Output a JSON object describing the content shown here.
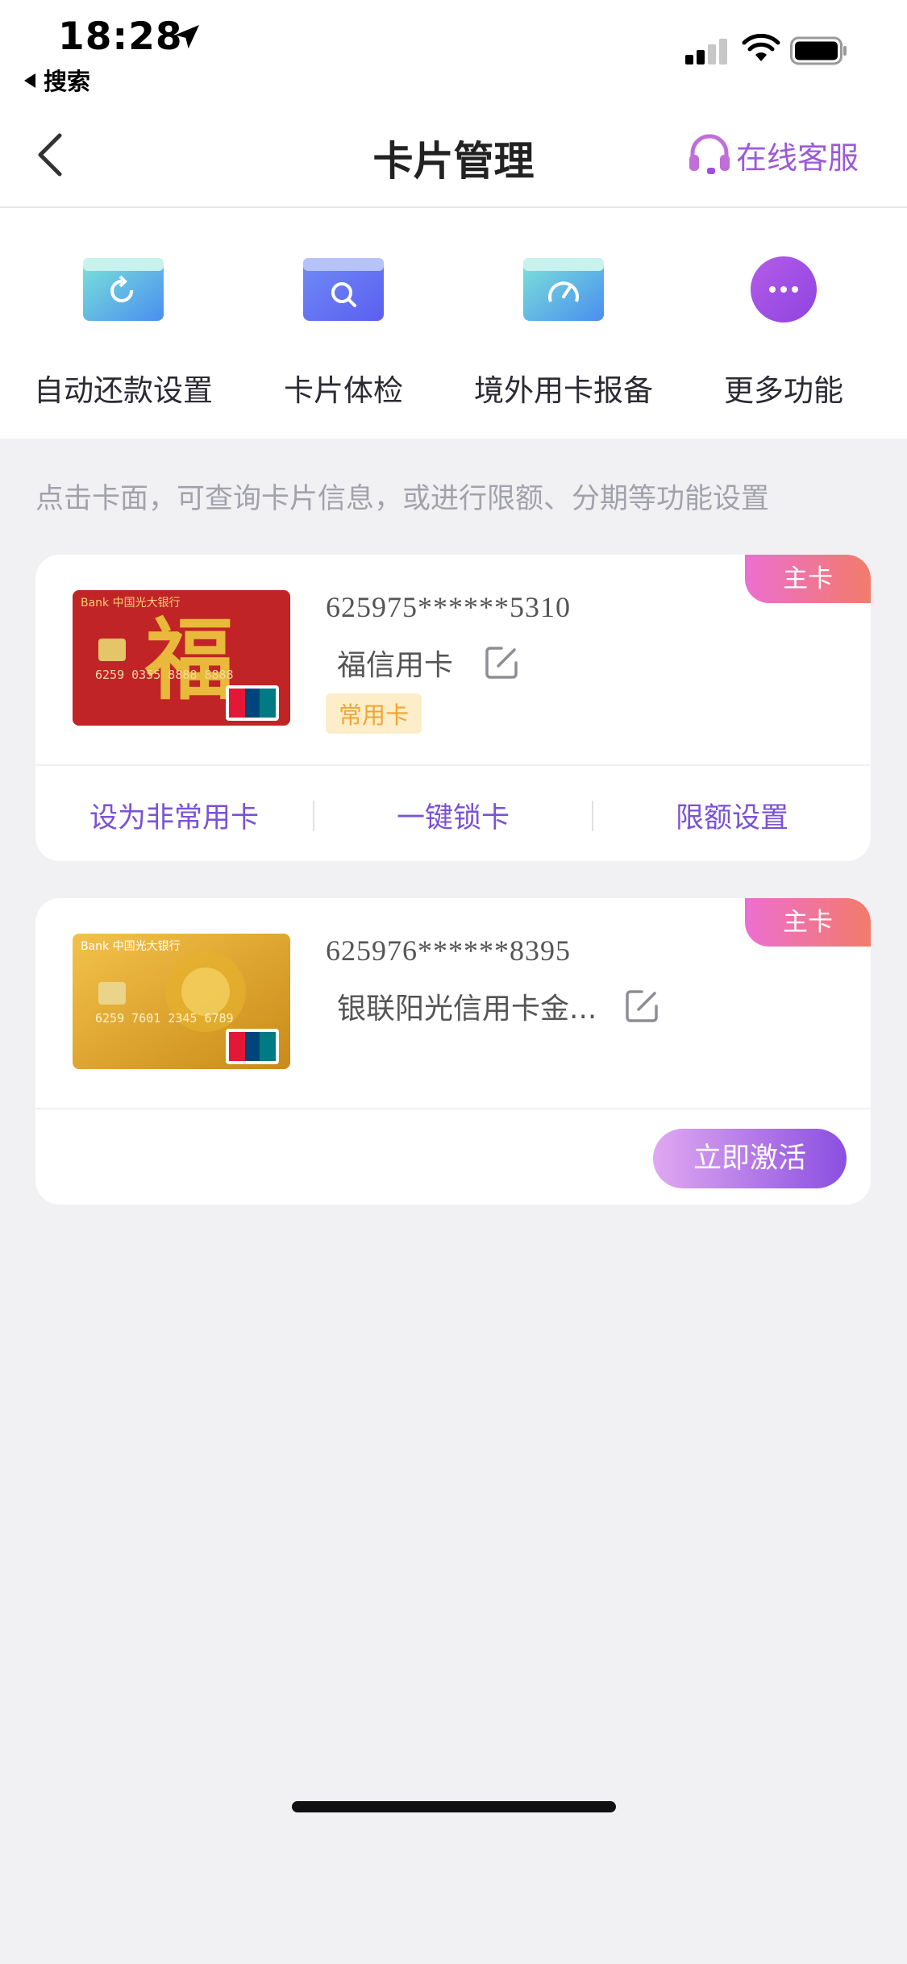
{
  "status_bar": {
    "time": "18:28",
    "back_label": "搜索"
  },
  "nav": {
    "title": "卡片管理",
    "service_label": "在线客服"
  },
  "quick_actions": [
    {
      "label": "自动还款设置",
      "icon": "auto-repay-icon"
    },
    {
      "label": "卡片体检",
      "icon": "card-check-icon"
    },
    {
      "label": "境外用卡报备",
      "icon": "overseas-report-icon"
    },
    {
      "label": "更多功能",
      "icon": "more-icon"
    }
  ],
  "hint": "点击卡面，可查询卡片信息，或进行限额、分期等功能设置",
  "cards": [
    {
      "badge": "主卡",
      "number": "625975******5310",
      "name": "福信用卡",
      "tag": "常用卡",
      "actions": [
        "设为非常用卡",
        "一键锁卡",
        "限额设置"
      ]
    },
    {
      "badge": "主卡",
      "number": "625976******8395",
      "name": "银联阳光信用卡金...",
      "button": "立即激活"
    }
  ],
  "colors": {
    "accent": "#7a52d6",
    "badge_start": "#ec6fd0",
    "badge_end": "#f27b6a",
    "tag_bg": "#fdeec9",
    "tag_text": "#f3a531"
  }
}
